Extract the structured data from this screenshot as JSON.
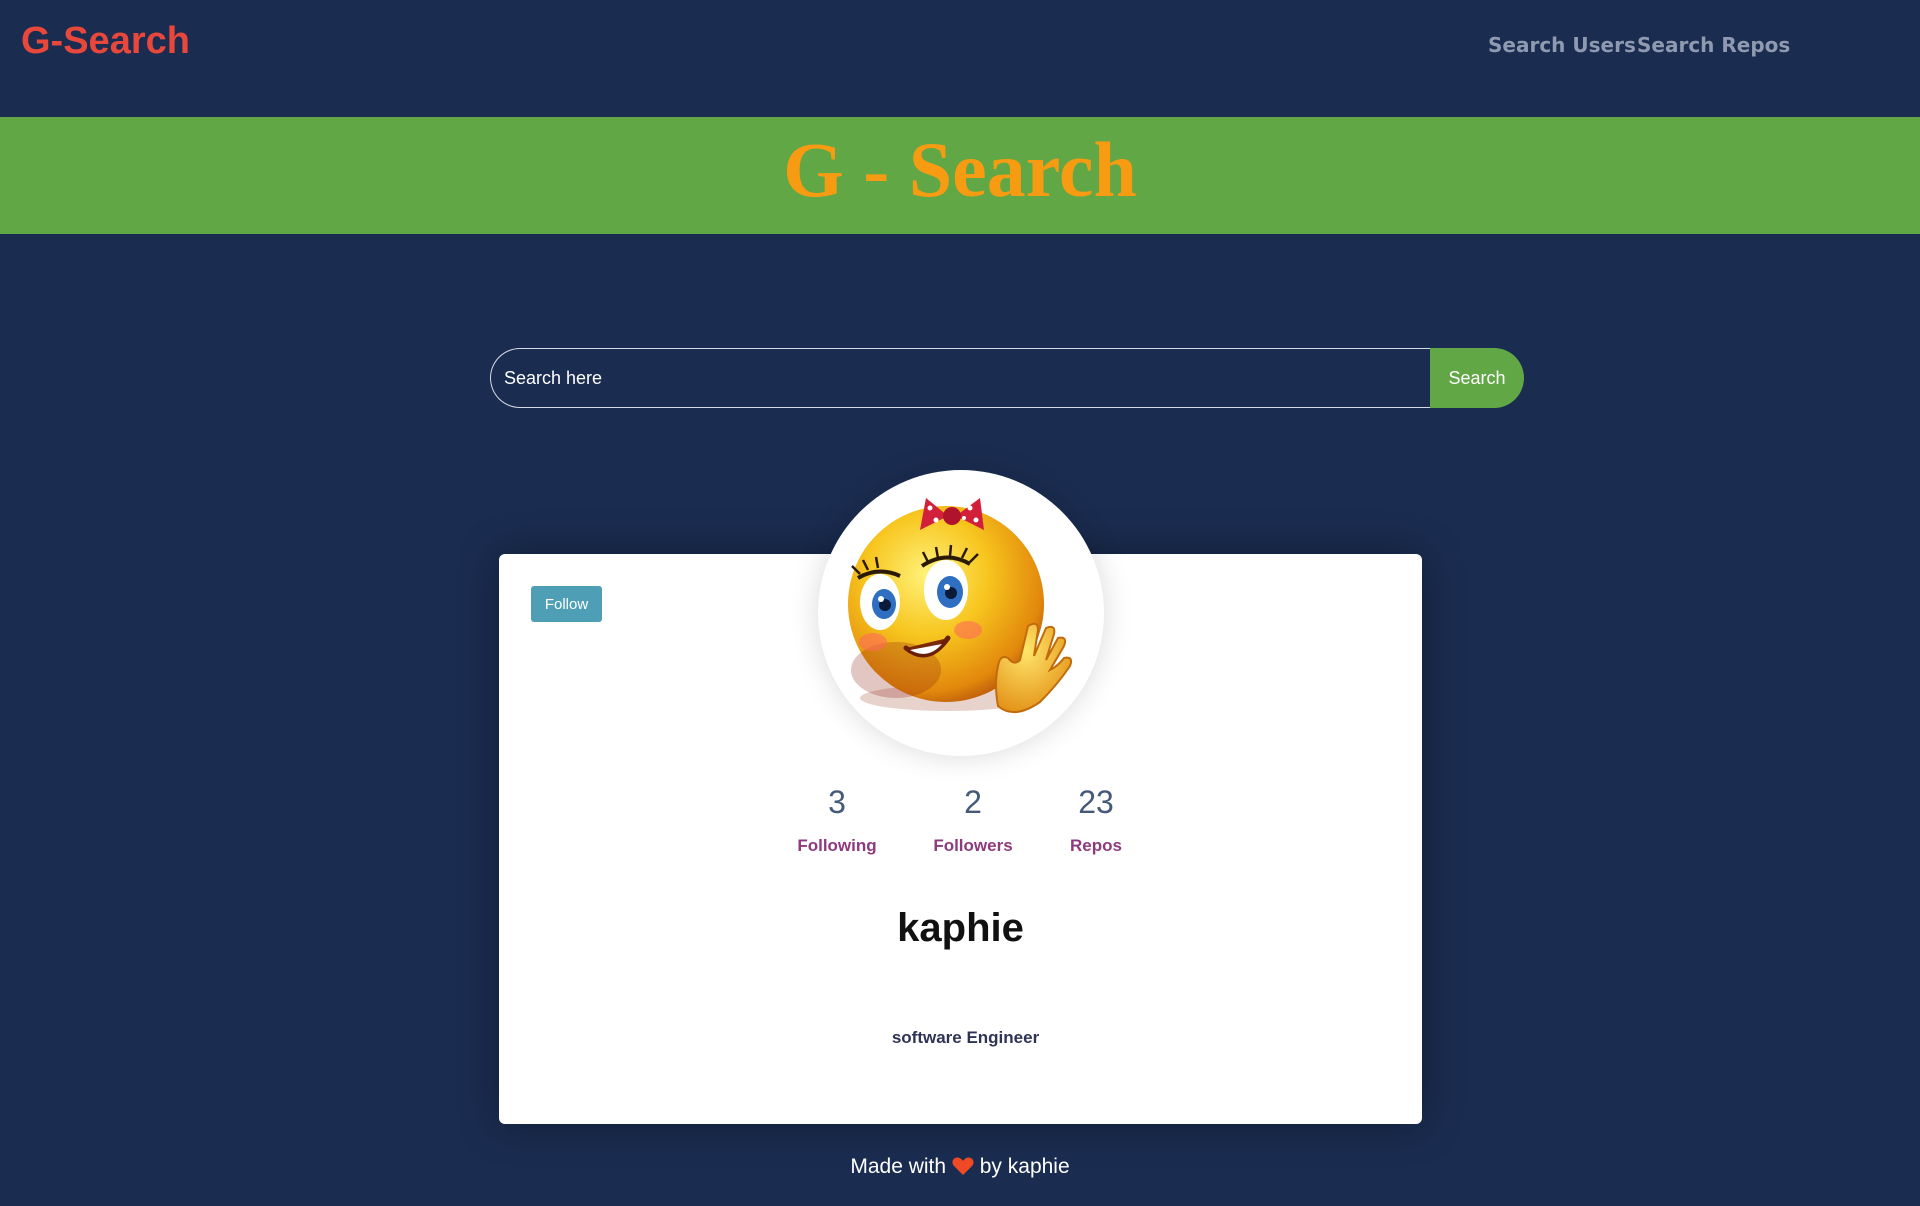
{
  "navbar": {
    "brand": "G-Search",
    "links": [
      "Search Users",
      "Search Repos"
    ]
  },
  "banner": {
    "title": "G - Search"
  },
  "search": {
    "placeholder": "Search here",
    "value": "",
    "button_label": "Search"
  },
  "profile": {
    "follow_label": "Follow",
    "avatar_icon": "smiley-emoji-icon",
    "stats": [
      {
        "value": "3",
        "label": "Following"
      },
      {
        "value": "2",
        "label": "Followers"
      },
      {
        "value": "23",
        "label": "Repos"
      }
    ],
    "username": "kaphie",
    "bio": "software Engineer"
  },
  "footer": {
    "prefix": "Made with",
    "heart_icon": "heart-icon",
    "suffix": "by kaphie"
  },
  "colors": {
    "background": "#1a2c50",
    "brand": "#e8473b",
    "banner": "#61a745",
    "banner_title": "#f79b12",
    "follow": "#4e9fb5",
    "stat_label": "#8e3a7e",
    "heart": "#ef4a25"
  }
}
